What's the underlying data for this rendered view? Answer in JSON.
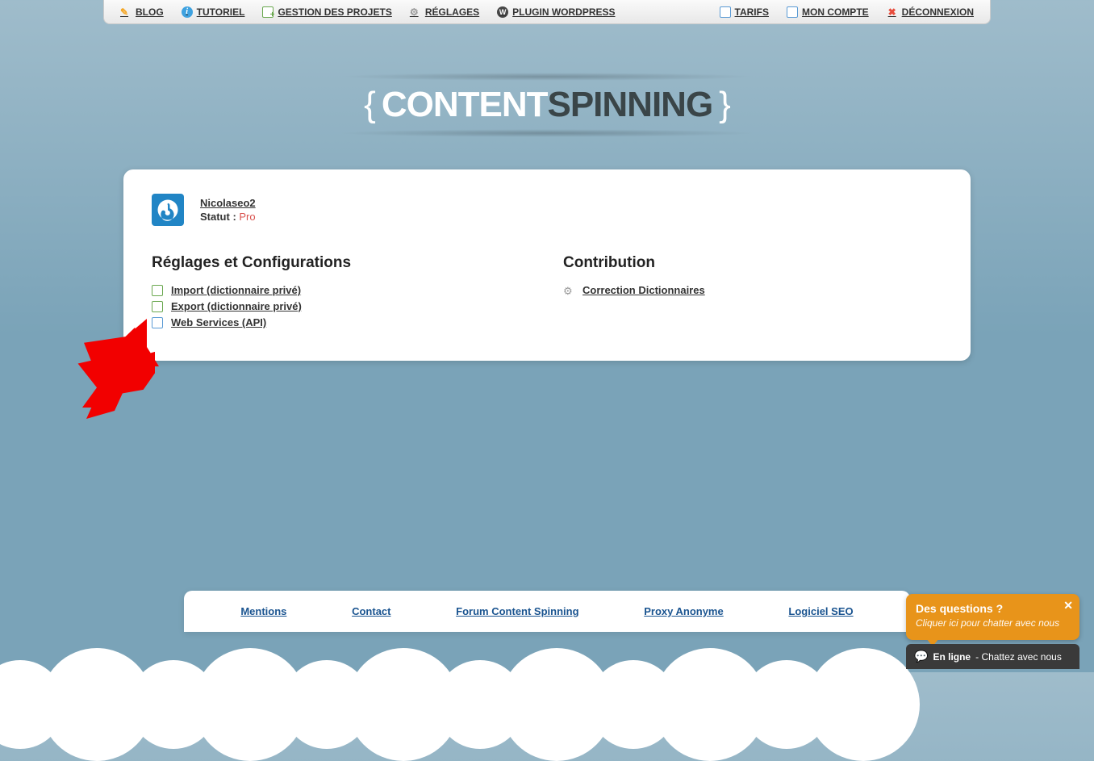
{
  "nav": {
    "left": [
      {
        "label": "BLOG"
      },
      {
        "label": "TUTORIEL"
      },
      {
        "label": "GESTION DES PROJETS"
      },
      {
        "label": "RÉGLAGES"
      },
      {
        "label": "PLUGIN WORDPRESS"
      }
    ],
    "right": [
      {
        "label": "TARIFS"
      },
      {
        "label": "MON COMPTE"
      },
      {
        "label": "DÉCONNEXION"
      }
    ]
  },
  "logo": {
    "brace_l": "{",
    "word1": "CONTENT",
    "word2": "SPINNING",
    "brace_r": "}"
  },
  "user": {
    "name": "Nicolaseo2",
    "status_label": "Statut : ",
    "status_value": "Pro"
  },
  "settings": {
    "heading": "Réglages et Configurations",
    "items": [
      {
        "label": "Import (dictionnaire privé)"
      },
      {
        "label": "Export (dictionnaire privé)"
      },
      {
        "label": "Web Services (API)"
      }
    ]
  },
  "contribution": {
    "heading": "Contribution",
    "items": [
      {
        "label": "Correction Dictionnaires"
      }
    ]
  },
  "footer": {
    "links": [
      "Mentions",
      "Contact",
      "Forum Content Spinning",
      "Proxy Anonyme",
      "Logiciel SEO"
    ]
  },
  "chat": {
    "popup_title": "Des questions ?",
    "popup_sub": "Cliquer ici pour chatter avec nous",
    "bar_status": "En ligne",
    "bar_text": " - Chattez avec nous"
  }
}
